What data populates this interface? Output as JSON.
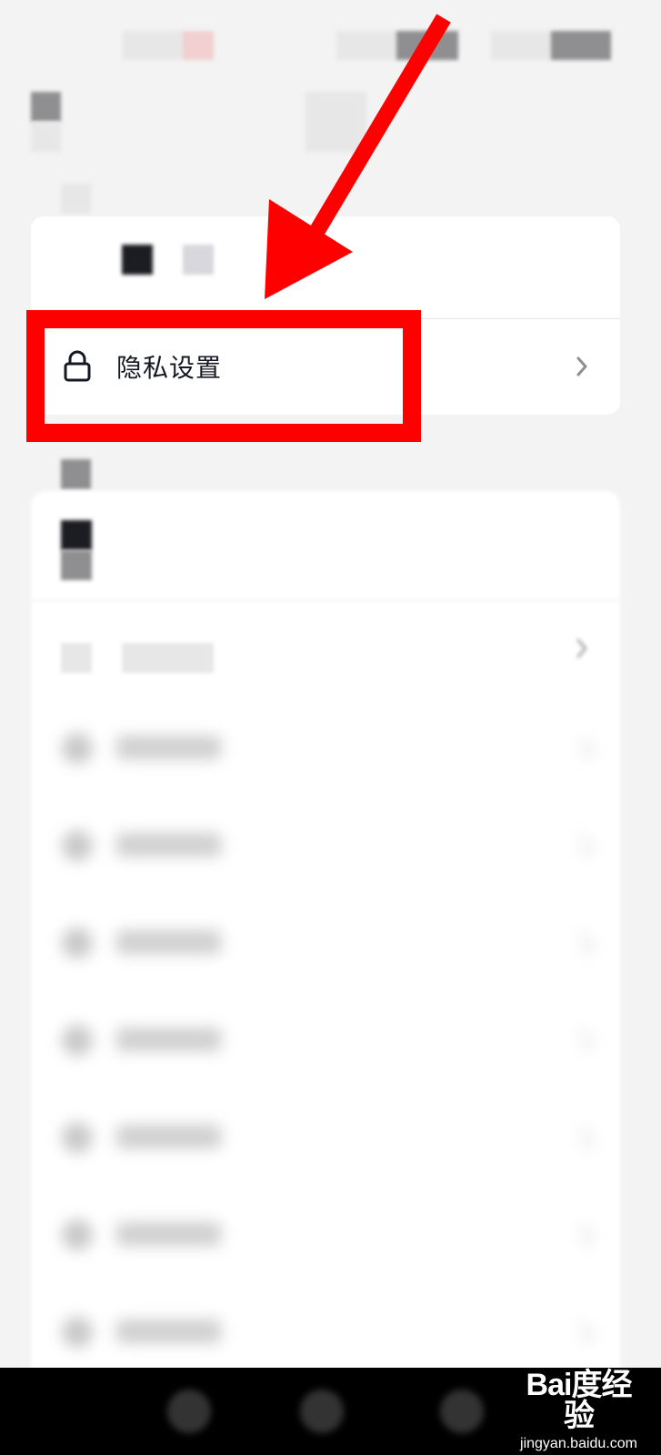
{
  "settings": {
    "privacy_label": "隐私设置"
  },
  "icons": {
    "privacy": "lock-icon",
    "chevron": "chevron-right-icon"
  },
  "watermark": {
    "brand": "Bai度经验",
    "url": "jingyan.baidu.com"
  },
  "colors": {
    "annotation": "#ff0000",
    "background": "#f3f3f3",
    "card": "#ffffff",
    "text": "#161823"
  }
}
